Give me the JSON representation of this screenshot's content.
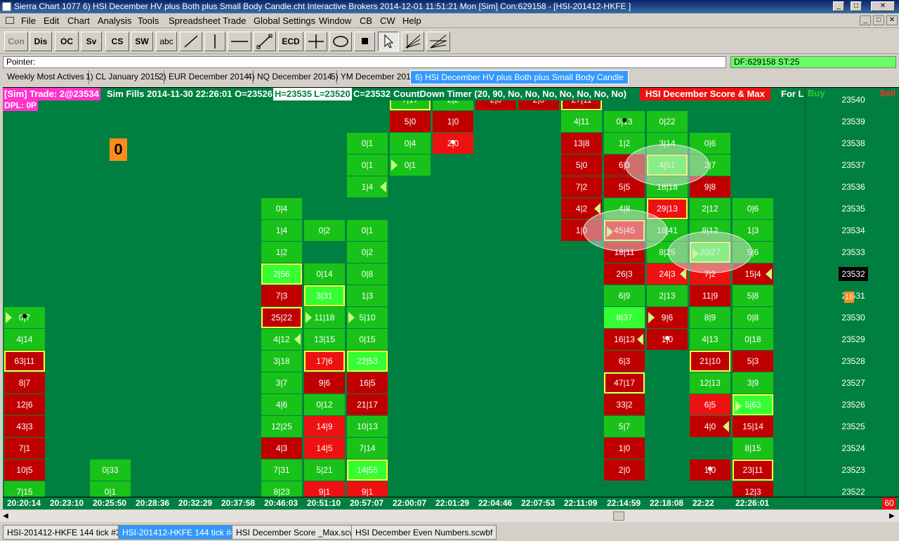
{
  "window": {
    "title": "Sierra Chart 1077 6) HSI December HV plus Both plus Small Body Candle.cht  Interactive Brokers 2014-12-01  11:51:21 Mon [Sim]  Con:629158 - [HSI-201412-HKFE ]",
    "controls": [
      "_",
      "□",
      "✕"
    ]
  },
  "menu": [
    "File",
    "Edit",
    "Chart",
    "Analysis",
    "Tools",
    "Spreadsheet",
    "Trade",
    "Global Settings",
    "Window",
    "CB",
    "CW",
    "Help"
  ],
  "toolbar": {
    "buttons": [
      "Con",
      "Dis",
      "OC",
      "Sv",
      "CS",
      "SW",
      "abc",
      "ECD"
    ],
    "icons": [
      "diagonal-line-icon",
      "vertical-line-icon",
      "horizontal-line-icon",
      "ray-icon",
      "crosshair-icon",
      "ellipse-icon",
      "square-icon",
      "pointer-icon",
      "fan-icon",
      "fan2-icon"
    ]
  },
  "pointer_bar": {
    "label": "Pointer:",
    "df": "DF:629158  ST:25"
  },
  "chart_tabs": [
    {
      "label": "Weekly Most Actives",
      "active": false
    },
    {
      "label": "1) CL January 2015",
      "active": false
    },
    {
      "label": "2) EUR December 2014",
      "active": false
    },
    {
      "label": "4) NQ December 2014",
      "active": false
    },
    {
      "label": "5) YM December 2014",
      "active": false
    },
    {
      "label": "6) HSI December HV plus Both plus Small Body Candle",
      "active": true
    }
  ],
  "chart_header": {
    "sim": "[Sim]  Trade: 2@23534",
    "fills": "Sim Fills  2014-11-30 22:26:01 O=23526",
    "high": "H=23535",
    "low": "L=23520",
    "close": "C=23532",
    "countdown": "CountDown Timer  (20, 90, No, No, No, No, No, No, No)",
    "study": "HSI December Score & Max",
    "for": "For L",
    "buy": "Buy",
    "sell": "Sell",
    "dpl": "DPL: 0P"
  },
  "overlay_value": "0",
  "price_scale": {
    "labels": [
      "23540",
      "23539",
      "23538",
      "23537",
      "23536",
      "23535",
      "23534",
      "23533",
      "23532",
      "23531",
      "23530",
      "23529",
      "23528",
      "23527",
      "23526",
      "23525",
      "23524",
      "23523",
      "23522"
    ],
    "current": "23532",
    "marker": "16"
  },
  "x_axis": [
    "20:20:14",
    "20:23:10",
    "20:25:50",
    "20:28:36",
    "20:32:29",
    "20:37:58",
    "20:46:03",
    "20:51:10",
    "20:57:07",
    "22:00:07",
    "22:01:29",
    "22:04:46",
    "22:07:53",
    "22:11:09",
    "22:14:59",
    "22:18:08",
    "22:22",
    "22:26:01"
  ],
  "x_axis_right": "60",
  "columns": [
    {
      "cells": [
        {
          "t": "0|7",
          "p": 23530,
          "c": "lg",
          "tri": "r",
          "dot": 1
        },
        {
          "t": "4|14",
          "p": 23529,
          "c": "lg"
        },
        {
          "t": "63|11",
          "p": 23528,
          "c": "dr",
          "hl": 1
        },
        {
          "t": "8|7",
          "p": 23527,
          "c": "dr"
        },
        {
          "t": "12|6",
          "p": 23526,
          "c": "dr"
        },
        {
          "t": "43|3",
          "p": 23525,
          "c": "dr"
        },
        {
          "t": "7|1",
          "p": 23524,
          "c": "dr"
        },
        {
          "t": "10|5",
          "p": 23523,
          "c": "dr"
        },
        {
          "t": "7|15",
          "p": 23522,
          "c": "lg"
        }
      ]
    },
    {
      "cells": []
    },
    {
      "cells": [
        {
          "t": "0|33",
          "p": 23523,
          "c": "lg"
        },
        {
          "t": "0|1",
          "p": 23522,
          "c": "lg"
        }
      ]
    },
    {
      "cells": []
    },
    {
      "cells": []
    },
    {
      "cells": []
    },
    {
      "cells": [
        {
          "t": "0|4",
          "p": 23535,
          "c": "lg"
        },
        {
          "t": "1|4",
          "p": 23534,
          "c": "lg"
        },
        {
          "t": "1|2",
          "p": 23533,
          "c": "lg"
        },
        {
          "t": "2|56",
          "p": 23532,
          "c": "bg",
          "hl": 1
        },
        {
          "t": "7|3",
          "p": 23531,
          "c": "dr"
        },
        {
          "t": "25|22",
          "p": 23530,
          "c": "dr",
          "hl": 1
        },
        {
          "t": "4|12",
          "p": 23529,
          "c": "lg",
          "tri": "l"
        },
        {
          "t": "3|18",
          "p": 23528,
          "c": "lg"
        },
        {
          "t": "3|7",
          "p": 23527,
          "c": "lg"
        },
        {
          "t": "4|6",
          "p": 23526,
          "c": "lg"
        },
        {
          "t": "12|25",
          "p": 23525,
          "c": "lg"
        },
        {
          "t": "4|3",
          "p": 23524,
          "c": "dr"
        },
        {
          "t": "7|31",
          "p": 23523,
          "c": "lg"
        },
        {
          "t": "8|23",
          "p": 23522,
          "c": "lg"
        }
      ]
    },
    {
      "cells": [
        {
          "t": "0|2",
          "p": 23534,
          "c": "lg"
        },
        {
          "t": "0|14",
          "p": 23532,
          "c": "lg"
        },
        {
          "t": "3|31",
          "p": 23531,
          "c": "bg",
          "hl": 1
        },
        {
          "t": "11|18",
          "p": 23530,
          "c": "lg",
          "tri": "r"
        },
        {
          "t": "13|15",
          "p": 23529,
          "c": "lg"
        },
        {
          "t": "17|6",
          "p": 23528,
          "c": "r",
          "hl": 1
        },
        {
          "t": "9|6",
          "p": 23527,
          "c": "dr"
        },
        {
          "t": "0|12",
          "p": 23526,
          "c": "lg"
        },
        {
          "t": "14|9",
          "p": 23525,
          "c": "r"
        },
        {
          "t": "14|5",
          "p": 23524,
          "c": "r"
        },
        {
          "t": "5|21",
          "p": 23523,
          "c": "lg"
        },
        {
          "t": "9|1",
          "p": 23522,
          "c": "r"
        }
      ]
    },
    {
      "cells": [
        {
          "t": "0|1",
          "p": 23538,
          "c": "lg"
        },
        {
          "t": "0|1",
          "p": 23537,
          "c": "lg"
        },
        {
          "t": "1|4",
          "p": 23536,
          "c": "lg",
          "tri": "l"
        },
        {
          "t": "0|1",
          "p": 23534,
          "c": "lg"
        },
        {
          "t": "0|2",
          "p": 23533,
          "c": "lg"
        },
        {
          "t": "0|8",
          "p": 23532,
          "c": "lg"
        },
        {
          "t": "1|3",
          "p": 23531,
          "c": "lg"
        },
        {
          "t": "5|10",
          "p": 23530,
          "c": "lg",
          "tri": "r"
        },
        {
          "t": "0|15",
          "p": 23529,
          "c": "lg"
        },
        {
          "t": "22|53",
          "p": 23528,
          "c": "bg",
          "hl": 1
        },
        {
          "t": "16|5",
          "p": 23527,
          "c": "dr"
        },
        {
          "t": "21|17",
          "p": 23526,
          "c": "dr"
        },
        {
          "t": "10|13",
          "p": 23525,
          "c": "lg"
        },
        {
          "t": "7|14",
          "p": 23524,
          "c": "lg"
        },
        {
          "t": "14|55",
          "p": 23523,
          "c": "bg",
          "hl": 1
        },
        {
          "t": "9|1",
          "p": 23522,
          "c": "r"
        }
      ]
    },
    {
      "cells": [
        {
          "t": "7|17",
          "p": 23540,
          "c": "lg",
          "hl": 1
        },
        {
          "t": "5|0",
          "p": 23539,
          "c": "dr"
        },
        {
          "t": "0|4",
          "p": 23538,
          "c": "lg"
        },
        {
          "t": "0|1",
          "p": 23537,
          "c": "lg",
          "tri": "r"
        }
      ]
    },
    {
      "cells": [
        {
          "t": "2|2",
          "p": 23540,
          "c": "lg"
        },
        {
          "t": "1|0",
          "p": 23539,
          "c": "dr"
        },
        {
          "t": "2|0",
          "p": 23538,
          "c": "r",
          "dot": 1
        }
      ]
    },
    {
      "cells": [
        {
          "t": "2|0",
          "p": 23540,
          "c": "dr",
          "dot": 1
        }
      ]
    },
    {
      "cells": [
        {
          "t": "2|0",
          "p": 23540,
          "c": "dr"
        }
      ]
    },
    {
      "cells": [
        {
          "t": "27|11",
          "p": 23540,
          "c": "dr",
          "hl": 1
        },
        {
          "t": "4|11",
          "p": 23539,
          "c": "lg"
        },
        {
          "t": "13|8",
          "p": 23538,
          "c": "dr"
        },
        {
          "t": "5|0",
          "p": 23537,
          "c": "dr"
        },
        {
          "t": "7|2",
          "p": 23536,
          "c": "dr"
        },
        {
          "t": "4|2",
          "p": 23535,
          "c": "dr",
          "tri": "l"
        },
        {
          "t": "1|0",
          "p": 23534,
          "c": "dr"
        }
      ]
    },
    {
      "cells": [
        {
          "t": "0|13",
          "p": 23539,
          "c": "lg",
          "dot": 1
        },
        {
          "t": "1|2",
          "p": 23538,
          "c": "lg"
        },
        {
          "t": "6|3",
          "p": 23537,
          "c": "dr"
        },
        {
          "t": "5|5",
          "p": 23536,
          "c": "dr"
        },
        {
          "t": "4|8",
          "p": 23535,
          "c": "lg"
        },
        {
          "t": "45|45",
          "p": 23534,
          "c": "r",
          "hl": 1,
          "tri": "r"
        },
        {
          "t": "18|11",
          "p": 23533,
          "c": "dr"
        },
        {
          "t": "26|3",
          "p": 23532,
          "c": "dr"
        },
        {
          "t": "6|9",
          "p": 23531,
          "c": "lg"
        },
        {
          "t": "8|37",
          "p": 23530,
          "c": "bg"
        },
        {
          "t": "16|13",
          "p": 23529,
          "c": "dr",
          "tri": "l"
        },
        {
          "t": "6|3",
          "p": 23528,
          "c": "dr"
        },
        {
          "t": "47|17",
          "p": 23527,
          "c": "dr",
          "hl": 1
        },
        {
          "t": "33|2",
          "p": 23526,
          "c": "dr"
        },
        {
          "t": "5|7",
          "p": 23525,
          "c": "lg"
        },
        {
          "t": "1|0",
          "p": 23524,
          "c": "dr"
        },
        {
          "t": "2|0",
          "p": 23523,
          "c": "dr"
        }
      ]
    },
    {
      "cells": [
        {
          "t": "0|22",
          "p": 23539,
          "c": "lg"
        },
        {
          "t": "3|14",
          "p": 23538,
          "c": "lg"
        },
        {
          "t": "4|51",
          "p": 23537,
          "c": "bg",
          "hl": 1
        },
        {
          "t": "18|18",
          "p": 23536,
          "c": "lg"
        },
        {
          "t": "29|13",
          "p": 23535,
          "c": "r",
          "hl": 1
        },
        {
          "t": "18|41",
          "p": 23534,
          "c": "lg"
        },
        {
          "t": "8|25",
          "p": 23533,
          "c": "lg"
        },
        {
          "t": "24|3",
          "p": 23532,
          "c": "r",
          "tri": "l"
        },
        {
          "t": "2|13",
          "p": 23531,
          "c": "lg"
        },
        {
          "t": "9|6",
          "p": 23530,
          "c": "dr",
          "tri": "r"
        },
        {
          "t": "1|0",
          "p": 23529,
          "c": "dr",
          "dot": 1
        }
      ]
    },
    {
      "cells": [
        {
          "t": "0|6",
          "p": 23538,
          "c": "lg"
        },
        {
          "t": "2|7",
          "p": 23537,
          "c": "lg"
        },
        {
          "t": "9|8",
          "p": 23536,
          "c": "dr"
        },
        {
          "t": "2|12",
          "p": 23535,
          "c": "lg"
        },
        {
          "t": "8|12",
          "p": 23534,
          "c": "lg"
        },
        {
          "t": "20|27",
          "p": 23533,
          "c": "bg",
          "hl": 1,
          "tri": "r"
        },
        {
          "t": "7|2",
          "p": 23532,
          "c": "r"
        },
        {
          "t": "11|9",
          "p": 23531,
          "c": "dr"
        },
        {
          "t": "8|9",
          "p": 23530,
          "c": "lg"
        },
        {
          "t": "4|13",
          "p": 23529,
          "c": "lg"
        },
        {
          "t": "21|10",
          "p": 23528,
          "c": "dr",
          "hl": 1
        },
        {
          "t": "12|13",
          "p": 23527,
          "c": "lg"
        },
        {
          "t": "6|5",
          "p": 23526,
          "c": "r"
        },
        {
          "t": "4|0",
          "p": 23525,
          "c": "dr",
          "tri": "l"
        },
        {
          "t": "1|0",
          "p": 23523,
          "c": "dr",
          "dot": 1
        }
      ]
    },
    {
      "cells": [
        {
          "t": "0|6",
          "p": 23535,
          "c": "lg"
        },
        {
          "t": "1|3",
          "p": 23534,
          "c": "lg"
        },
        {
          "t": "5|6",
          "p": 23533,
          "c": "lg"
        },
        {
          "t": "15|4",
          "p": 23532,
          "c": "dr",
          "tri": "l"
        },
        {
          "t": "5|8",
          "p": 23531,
          "c": "lg"
        },
        {
          "t": "0|8",
          "p": 23530,
          "c": "lg"
        },
        {
          "t": "0|18",
          "p": 23529,
          "c": "lg"
        },
        {
          "t": "5|3",
          "p": 23528,
          "c": "dr"
        },
        {
          "t": "3|9",
          "p": 23527,
          "c": "lg"
        },
        {
          "t": "5|63",
          "p": 23526,
          "c": "bg",
          "hl": 1,
          "tri": "r"
        },
        {
          "t": "15|14",
          "p": 23525,
          "c": "dr"
        },
        {
          "t": "8|15",
          "p": 23524,
          "c": "lg"
        },
        {
          "t": "23|11",
          "p": 23523,
          "c": "dr",
          "hl": 1
        },
        {
          "t": "12|3",
          "p": 23522,
          "c": "dr"
        }
      ]
    }
  ],
  "bottom_tabs": [
    {
      "label": "HSI-201412-HKFE  144 tick  #3",
      "active": false
    },
    {
      "label": "HSI-201412-HKFE  144 tick  #4",
      "active": true
    },
    {
      "label": "HSI December Score _Max.scwbf",
      "active": false
    },
    {
      "label": "HSI December Even Numbers.scwbf",
      "active": false
    }
  ],
  "colors": {
    "chart_bg": "#008040",
    "buy": "#33cc33",
    "sell": "#ff3333",
    "sim": "#ff33cc",
    "study": "#ee1111"
  }
}
